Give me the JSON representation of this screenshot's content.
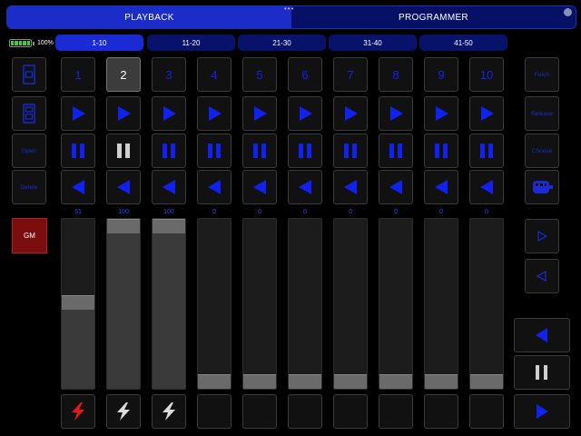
{
  "top_tabs": [
    {
      "label": "PLAYBACK",
      "active": true
    },
    {
      "label": "PROGRAMMER",
      "active": false
    }
  ],
  "battery": {
    "percent_text": "100%",
    "level": 1.0
  },
  "page_tabs": [
    {
      "label": "1-10",
      "active": true
    },
    {
      "label": "11-20",
      "active": false
    },
    {
      "label": "21-30",
      "active": false
    },
    {
      "label": "31-40",
      "active": false
    },
    {
      "label": "41-50",
      "active": false
    }
  ],
  "left_controls": {
    "open": "Open",
    "delete": "Delete",
    "gm": "GM"
  },
  "right_controls": {
    "fetch": "Fetch",
    "release": "Release",
    "choose": "Choose"
  },
  "playbacks": [
    {
      "number": "1",
      "selected": false,
      "value": "51",
      "level": 0.51,
      "flash_color": "#e01818"
    },
    {
      "number": "2",
      "selected": true,
      "value": "100",
      "level": 1.0,
      "flash_color": "#dcdcdc"
    },
    {
      "number": "3",
      "selected": false,
      "value": "100",
      "level": 1.0,
      "flash_color": "#dcdcdc"
    },
    {
      "number": "4",
      "selected": false,
      "value": "0",
      "level": 0,
      "flash_color": ""
    },
    {
      "number": "5",
      "selected": false,
      "value": "0",
      "level": 0,
      "flash_color": ""
    },
    {
      "number": "6",
      "selected": false,
      "value": "0",
      "level": 0,
      "flash_color": ""
    },
    {
      "number": "7",
      "selected": false,
      "value": "0",
      "level": 0,
      "flash_color": ""
    },
    {
      "number": "8",
      "selected": false,
      "value": "0",
      "level": 0,
      "flash_color": ""
    },
    {
      "number": "9",
      "selected": false,
      "value": "0",
      "level": 0,
      "flash_color": ""
    },
    {
      "number": "10",
      "selected": false,
      "value": "0",
      "level": 0,
      "flash_color": ""
    }
  ],
  "colors": {
    "accent": "#1122ee",
    "active_tab": "#1c2cc8",
    "gm_red": "#7a0e0e"
  }
}
